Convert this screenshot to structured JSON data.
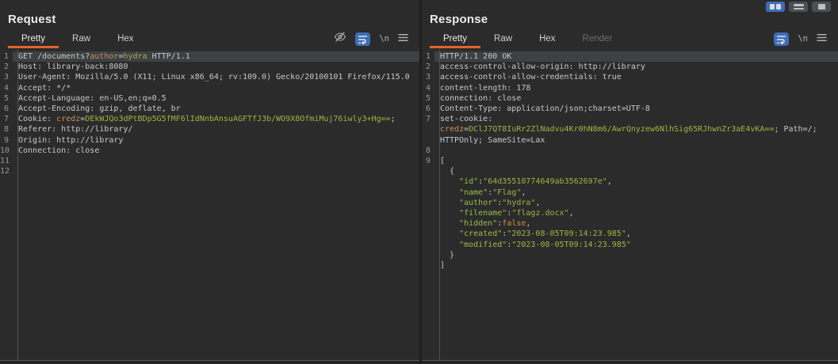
{
  "window": {
    "layout_buttons": [
      {
        "name": "split-columns",
        "active": true
      },
      {
        "name": "split-rows",
        "active": false
      },
      {
        "name": "single-pane",
        "active": false
      }
    ]
  },
  "accent_colors": {
    "tab_underline": "#e2632a",
    "active_button_blue": "#3e6db5",
    "param_name_orange": "#cb8d5e",
    "value_green": "#a3b341",
    "json_key_green": "#9dbb4a",
    "boolean_orange": "#d0903f"
  },
  "request": {
    "title": "Request",
    "tabs": [
      {
        "label": "Pretty",
        "state": "selected"
      },
      {
        "label": "Raw",
        "state": ""
      },
      {
        "label": "Hex",
        "state": ""
      }
    ],
    "tools": {
      "hide_icon": "eye-off",
      "wrap_button": "soft-wrap",
      "newline_label": "\\n",
      "menu_icon": "menu"
    },
    "lines": [
      {
        "n": "1",
        "hl": true,
        "s": [
          {
            "t": "GET /documents?",
            "c": "d"
          },
          {
            "t": "author",
            "c": "o"
          },
          {
            "t": "=",
            "c": "d"
          },
          {
            "t": "hydra",
            "c": "g"
          },
          {
            "t": " HTTP/1.1",
            "c": "d"
          }
        ]
      },
      {
        "n": "2",
        "s": [
          {
            "t": "Host: library-back:8080",
            "c": "d"
          }
        ]
      },
      {
        "n": "3",
        "s": [
          {
            "t": "User-Agent: Mozilla/5.0 (X11; Linux x86_64; rv:109.0) Gecko/20100101 Firefox/115.0",
            "c": "d"
          }
        ]
      },
      {
        "n": "4",
        "s": [
          {
            "t": "Accept: */*",
            "c": "d"
          }
        ]
      },
      {
        "n": "5",
        "s": [
          {
            "t": "Accept-Language: en-US,en;q=0.5",
            "c": "d"
          }
        ]
      },
      {
        "n": "6",
        "s": [
          {
            "t": "Accept-Encoding: gzip, deflate, br",
            "c": "d"
          }
        ]
      },
      {
        "n": "7",
        "s": [
          {
            "t": "Cookie: ",
            "c": "d"
          },
          {
            "t": "credz",
            "c": "o"
          },
          {
            "t": "=",
            "c": "d"
          },
          {
            "t": "DEkWJQo3dPtBDp5G5fMF6lIdNnbAnsuAGFTfJ3b/WO9X8OfmiMuj76iwly3+Hg==",
            "c": "g"
          },
          {
            "t": ";",
            "c": "d"
          }
        ]
      },
      {
        "n": "8",
        "s": [
          {
            "t": "Referer: http://library/",
            "c": "d"
          }
        ]
      },
      {
        "n": "9",
        "s": [
          {
            "t": "Origin: http://library",
            "c": "d"
          }
        ]
      },
      {
        "n": "10",
        "s": [
          {
            "t": "Connection: close",
            "c": "d"
          }
        ]
      },
      {
        "n": "11",
        "s": []
      },
      {
        "n": "12",
        "s": []
      }
    ]
  },
  "response": {
    "title": "Response",
    "tabs": [
      {
        "label": "Pretty",
        "state": "selected"
      },
      {
        "label": "Raw",
        "state": ""
      },
      {
        "label": "Hex",
        "state": ""
      },
      {
        "label": "Render",
        "state": "disabled"
      }
    ],
    "tools": {
      "wrap_button": "soft-wrap",
      "newline_label": "\\n",
      "menu_icon": "menu"
    },
    "lines": [
      {
        "n": "1",
        "hl": true,
        "s": [
          {
            "t": "HTTP/1.1 200 OK",
            "c": "d"
          }
        ]
      },
      {
        "n": "2",
        "s": [
          {
            "t": "access-control-allow-origin: http://library",
            "c": "d"
          }
        ]
      },
      {
        "n": "3",
        "s": [
          {
            "t": "access-control-allow-credentials: true",
            "c": "d"
          }
        ]
      },
      {
        "n": "4",
        "s": [
          {
            "t": "content-length: 178",
            "c": "d"
          }
        ]
      },
      {
        "n": "5",
        "s": [
          {
            "t": "connection: close",
            "c": "d"
          }
        ]
      },
      {
        "n": "6",
        "s": [
          {
            "t": "Content-Type: application/json;charset=UTF-8",
            "c": "d"
          }
        ]
      },
      {
        "n": "7",
        "s": [
          {
            "t": "set-cookie: ",
            "c": "d"
          },
          {
            "t": "credz",
            "c": "o"
          },
          {
            "t": "=",
            "c": "d"
          },
          {
            "t": "DClJ7QT8IuRr2ZlNadvu4Kr0hN8m6/AwrQnyzew6NlhSig65RJhwnZr3aE4vKA==",
            "c": "g"
          },
          {
            "t": "; Path=/; HTTPOnly; SameSite=Lax",
            "c": "d"
          }
        ]
      },
      {
        "n": "8",
        "s": []
      },
      {
        "n": "9",
        "s": [
          {
            "t": "[\n  {\n    ",
            "c": "d"
          },
          {
            "t": "\"id\"",
            "c": "k"
          },
          {
            "t": ":",
            "c": "d"
          },
          {
            "t": "\"64d35510774649ab3562697e\"",
            "c": "g"
          },
          {
            "t": ",\n    ",
            "c": "d"
          },
          {
            "t": "\"name\"",
            "c": "k"
          },
          {
            "t": ":",
            "c": "d"
          },
          {
            "t": "\"Flag\"",
            "c": "g"
          },
          {
            "t": ",\n    ",
            "c": "d"
          },
          {
            "t": "\"author\"",
            "c": "k"
          },
          {
            "t": ":",
            "c": "d"
          },
          {
            "t": "\"hydra\"",
            "c": "g"
          },
          {
            "t": ",\n    ",
            "c": "d"
          },
          {
            "t": "\"filename\"",
            "c": "k"
          },
          {
            "t": ":",
            "c": "d"
          },
          {
            "t": "\"flagz.docx\"",
            "c": "g"
          },
          {
            "t": ",\n    ",
            "c": "d"
          },
          {
            "t": "\"hidden\"",
            "c": "k"
          },
          {
            "t": ":",
            "c": "d"
          },
          {
            "t": "false",
            "c": "b"
          },
          {
            "t": ",\n    ",
            "c": "d"
          },
          {
            "t": "\"created\"",
            "c": "k"
          },
          {
            "t": ":",
            "c": "d"
          },
          {
            "t": "\"2023-08-05T09:14:23.985\"",
            "c": "g"
          },
          {
            "t": ",\n    ",
            "c": "d"
          },
          {
            "t": "\"modified\"",
            "c": "k"
          },
          {
            "t": ":",
            "c": "d"
          },
          {
            "t": "\"2023-08-05T09:14:23.985\"",
            "c": "g"
          },
          {
            "t": "\n  }\n]",
            "c": "d"
          }
        ]
      }
    ]
  }
}
